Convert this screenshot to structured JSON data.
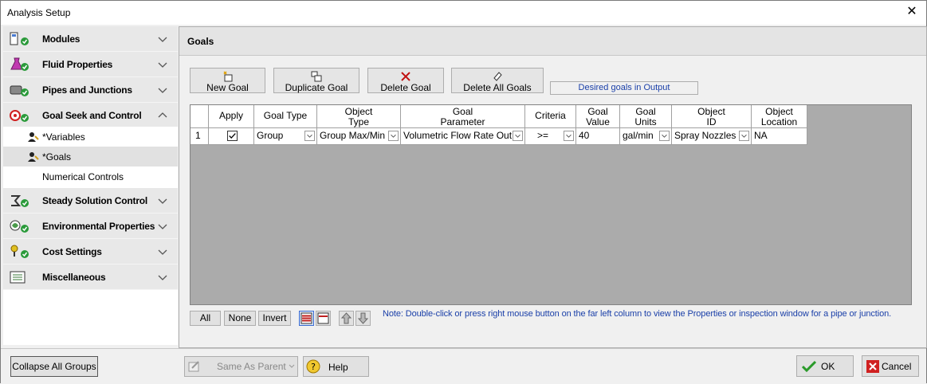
{
  "window": {
    "title": "Analysis Setup"
  },
  "sidebar": {
    "groups": [
      {
        "label": "Modules",
        "icon": "modules-icon"
      },
      {
        "label": "Fluid Properties",
        "icon": "flask-icon"
      },
      {
        "label": "Pipes and Junctions",
        "icon": "pipe-icon"
      },
      {
        "label": "Goal Seek and Control",
        "icon": "target-icon"
      }
    ],
    "sub_items": [
      {
        "label": "*Variables"
      },
      {
        "label": "*Goals"
      },
      {
        "label": "Numerical Controls"
      }
    ],
    "groups2": [
      {
        "label": "Steady Solution Control",
        "icon": "solver-icon"
      },
      {
        "label": "Environmental Properties",
        "icon": "environment-icon"
      },
      {
        "label": "Cost Settings",
        "icon": "cost-icon"
      },
      {
        "label": "Miscellaneous",
        "icon": "misc-icon"
      }
    ]
  },
  "main": {
    "header": "Goals",
    "toolbar": {
      "new_goal": "New Goal",
      "duplicate_goal": "Duplicate Goal",
      "delete_goal": "Delete Goal",
      "delete_all_goals": "Delete All Goals",
      "status": "Desired goals in Output"
    },
    "grid": {
      "headers": {
        "apply": "Apply",
        "goal_type": "Goal Type",
        "object_type_1": "Object",
        "object_type_2": "Type",
        "goal_param_1": "Goal",
        "goal_param_2": "Parameter",
        "criteria": "Criteria",
        "goal_value_1": "Goal",
        "goal_value_2": "Value",
        "goal_units_1": "Goal",
        "goal_units_2": "Units",
        "object_id_1": "Object",
        "object_id_2": "ID",
        "object_loc_1": "Object",
        "object_loc_2": "Location"
      },
      "rows": [
        {
          "num": "1",
          "apply": true,
          "goal_type": "Group",
          "object_type": "Group Max/Min",
          "goal_parameter": "Volumetric Flow Rate Out",
          "criteria": ">=",
          "goal_value": "40",
          "goal_units": "gal/min",
          "object_id": "Spray Nozzles",
          "object_location": "NA"
        }
      ]
    },
    "select": {
      "all": "All",
      "none": "None",
      "invert": "Invert"
    },
    "note": "Note: Double-click or press right mouse button on the far left column to view the Properties or inspection window for a pipe or junction."
  },
  "footer": {
    "collapse": "Collapse All Groups",
    "same_as_parent": "Same As Parent",
    "help": "Help",
    "ok": "OK",
    "cancel": "Cancel"
  }
}
